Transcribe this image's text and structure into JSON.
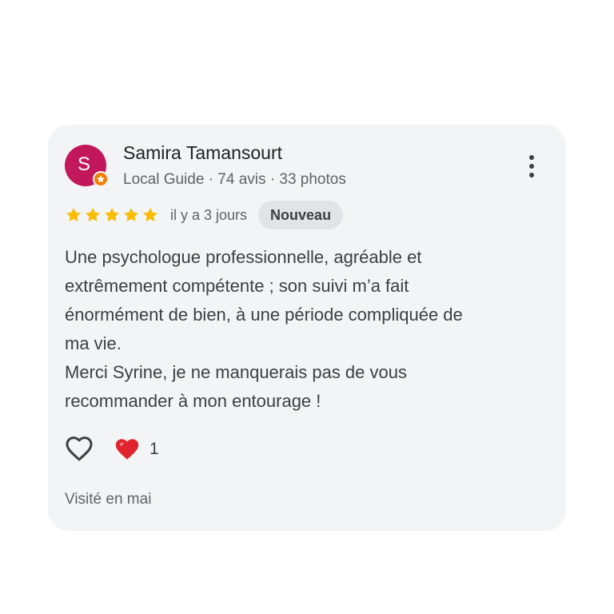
{
  "colors": {
    "avatar_bg": "#c2185b",
    "guide_badge": "#f57c00",
    "star": "#fbbc04",
    "heart_reaction": "#e0242f"
  },
  "reviewer": {
    "avatar_letter": "S",
    "name": "Samira Tamansourt",
    "meta": "Local Guide · 74 avis · 33 photos"
  },
  "menu": {
    "icon": "more-vert-icon"
  },
  "rating": {
    "stars": 5,
    "max_stars": 5,
    "time": "il y a 3 jours",
    "badge": "Nouveau"
  },
  "review": {
    "lines": [
      "Une psychologue professionnelle, agréable et",
      "extrêmement compétente ; son suivi m’a fait",
      "énormément de bien, à une période compliquée de",
      "ma vie.",
      "Merci Syrine, je ne manquerais pas de vous",
      "recommander à mon entourage !"
    ]
  },
  "actions": {
    "like_icon": "heart-outline-icon",
    "reaction_icon": "red-heart-icon",
    "reaction_count": "1"
  },
  "visited": "Visité en mai"
}
